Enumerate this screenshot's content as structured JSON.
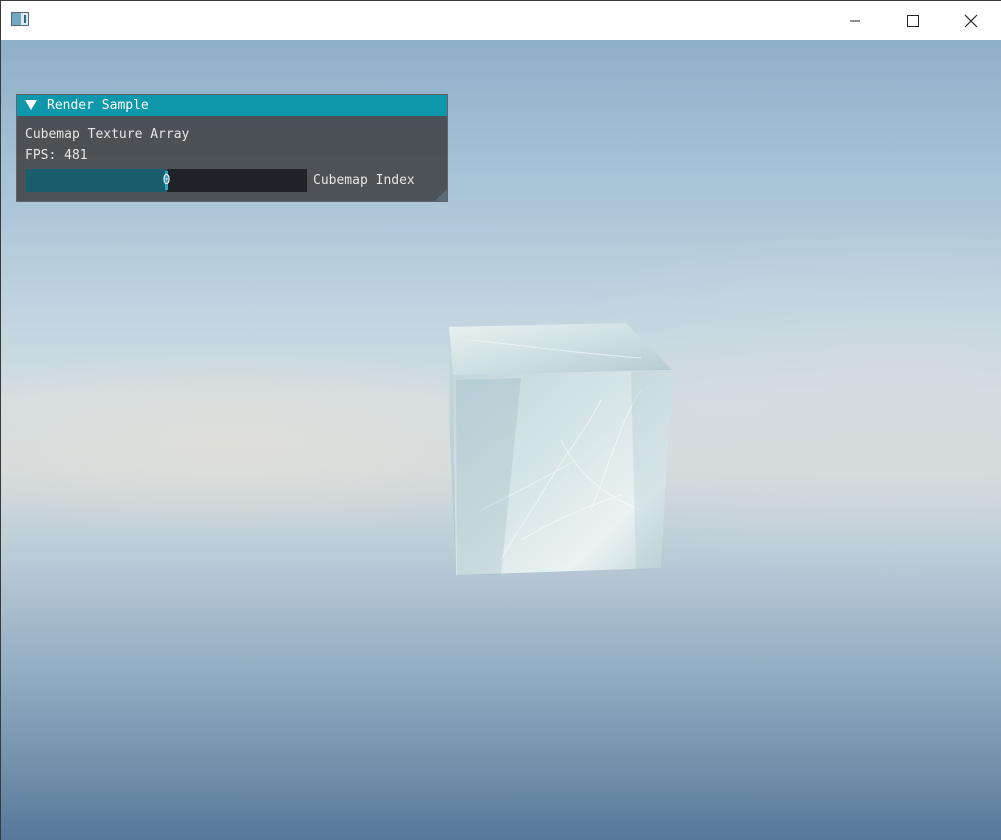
{
  "window": {
    "title": "",
    "icon": "app-icon",
    "controls": [
      "minimize-icon",
      "maximize-icon",
      "close-icon"
    ]
  },
  "panel": {
    "title": "Render Sample",
    "collapsed": false,
    "heading": "Cubemap Texture Array",
    "fps_text": "FPS: 481",
    "slider": {
      "label": "Cubemap Index",
      "value": "0",
      "fill_fraction": 0.5
    }
  },
  "colors": {
    "panel_title": "#0f97ab",
    "slider_fill": "#1a5d6d",
    "slider_grab": "#2aa6bf"
  }
}
